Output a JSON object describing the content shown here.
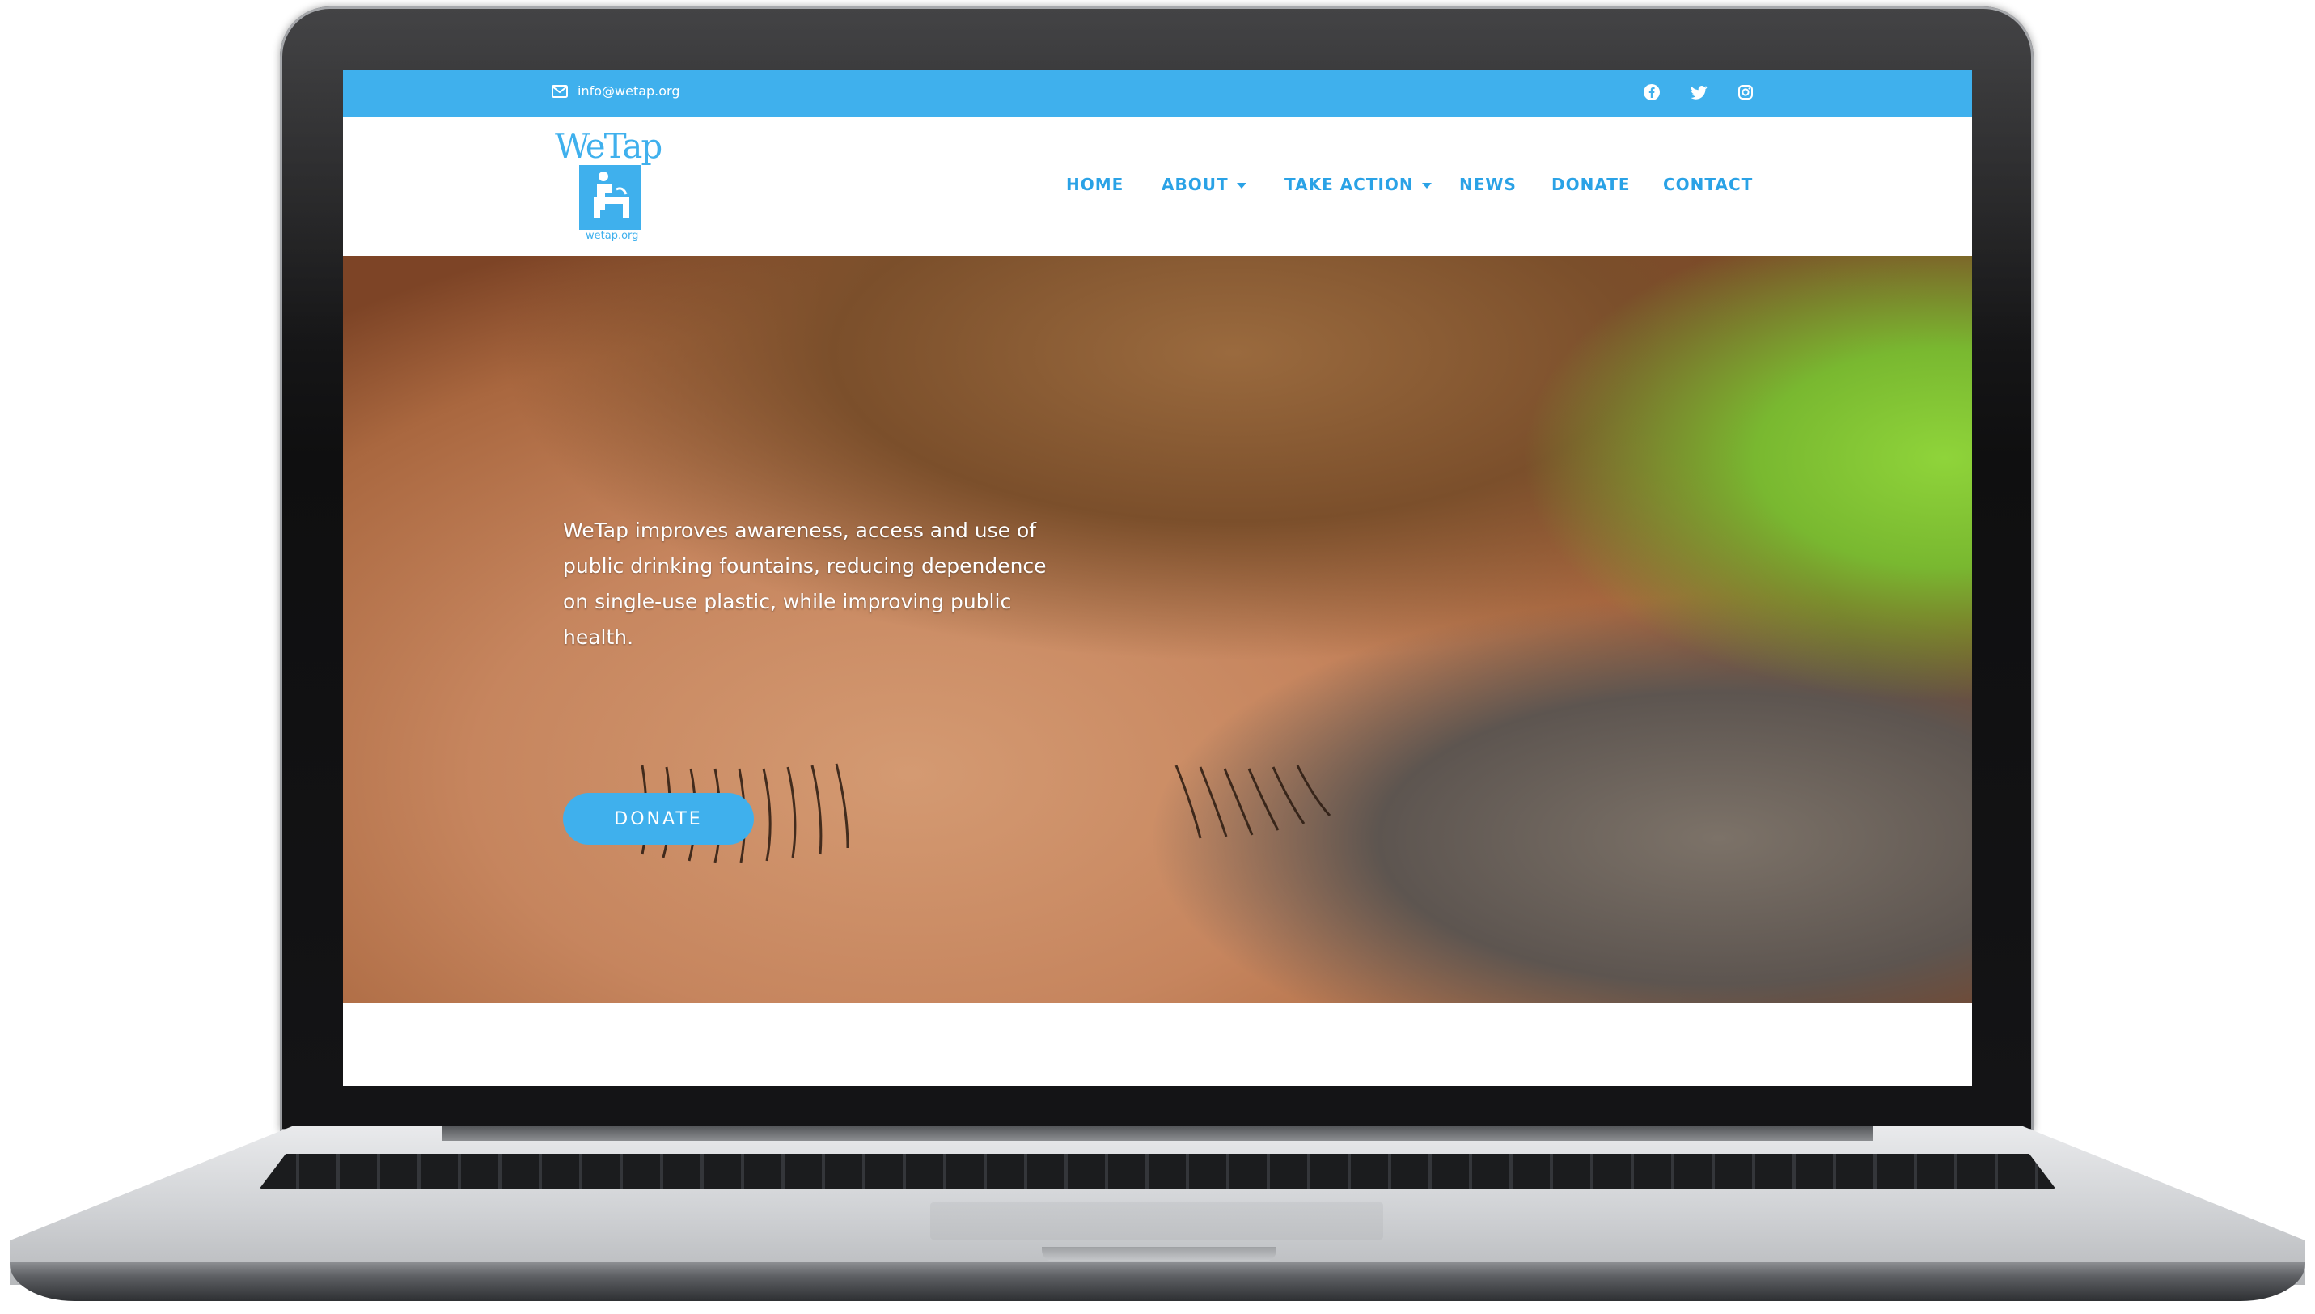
{
  "topbar": {
    "email": "info@wetap.org",
    "social_icons": [
      "facebook-icon",
      "twitter-icon",
      "instagram-icon"
    ],
    "color": "#3fb0ed"
  },
  "logo": {
    "wordmark": "WeTap",
    "subtext": "wetap.org"
  },
  "nav": {
    "items": [
      {
        "label": "HOME"
      },
      {
        "label": "ABOUT"
      },
      {
        "label": "TAKE ACTION"
      },
      {
        "label": "NEWS"
      },
      {
        "label": "DONATE"
      },
      {
        "label": "CONTACT"
      }
    ],
    "color": "#2aa2e6"
  },
  "hero": {
    "text": "WeTap improves awareness, access and use of public drinking fountains, reducing dependence on single-use plastic, while improving public health.",
    "button_label": "DONATE"
  }
}
